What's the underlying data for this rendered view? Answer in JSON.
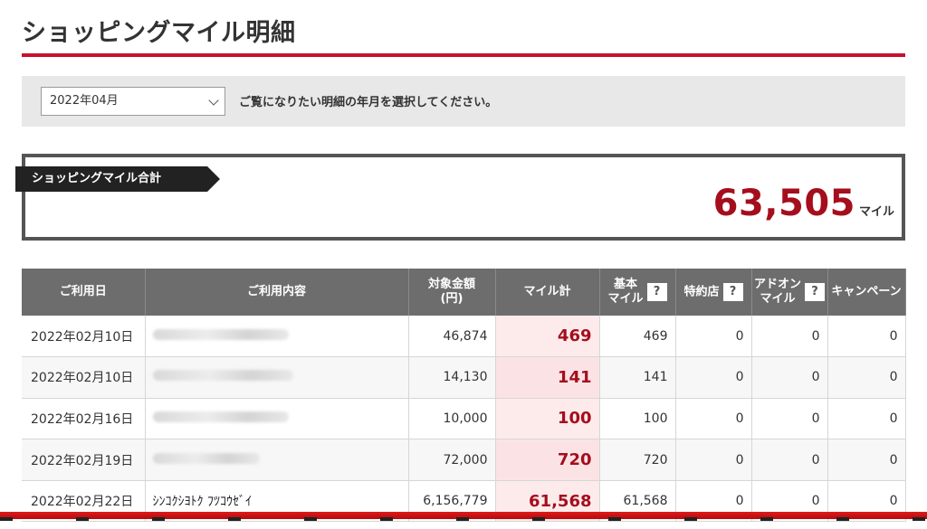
{
  "header": {
    "title": "ショッピングマイル明細"
  },
  "filter": {
    "selected_month": "2022年04月",
    "hint": "ご覧になりたい明細の年月を選択してください。"
  },
  "summary": {
    "label": "ショッピングマイル合計",
    "value": "63,505",
    "unit": "マイル"
  },
  "table": {
    "headers": {
      "date": "ご利用日",
      "content": "ご利用内容",
      "amount_line1": "対象金額",
      "amount_line2": "(円)",
      "miles_total": "マイル計",
      "basic_line1": "基本",
      "basic_line2": "マイル",
      "partner": "特約店",
      "addon_line1": "アドオン",
      "addon_line2": "マイル",
      "campaign": "キャンペーン",
      "help": "?"
    },
    "rows": [
      {
        "date": "2022年02月10日",
        "content": "",
        "amount": "46,874",
        "miles": "469",
        "basic": "469",
        "partner": "0",
        "addon": "0",
        "campaign": "0"
      },
      {
        "date": "2022年02月10日",
        "content": "",
        "amount": "14,130",
        "miles": "141",
        "basic": "141",
        "partner": "0",
        "addon": "0",
        "campaign": "0"
      },
      {
        "date": "2022年02月16日",
        "content": "",
        "amount": "10,000",
        "miles": "100",
        "basic": "100",
        "partner": "0",
        "addon": "0",
        "campaign": "0"
      },
      {
        "date": "2022年02月19日",
        "content": "",
        "amount": "72,000",
        "miles": "720",
        "basic": "720",
        "partner": "0",
        "addon": "0",
        "campaign": "0"
      },
      {
        "date": "2022年02月22日",
        "content": "ｼﾝｺｸｼﾖﾄｸ ﾌﾂｺｳｾﾞｲ",
        "amount": "6,156,779",
        "miles": "61,568",
        "basic": "61,568",
        "partner": "0",
        "addon": "0",
        "campaign": "0"
      }
    ]
  },
  "colors": {
    "accent": "#c8102e",
    "mile_text": "#a50e1c",
    "header_bg": "#6d6d6d"
  }
}
